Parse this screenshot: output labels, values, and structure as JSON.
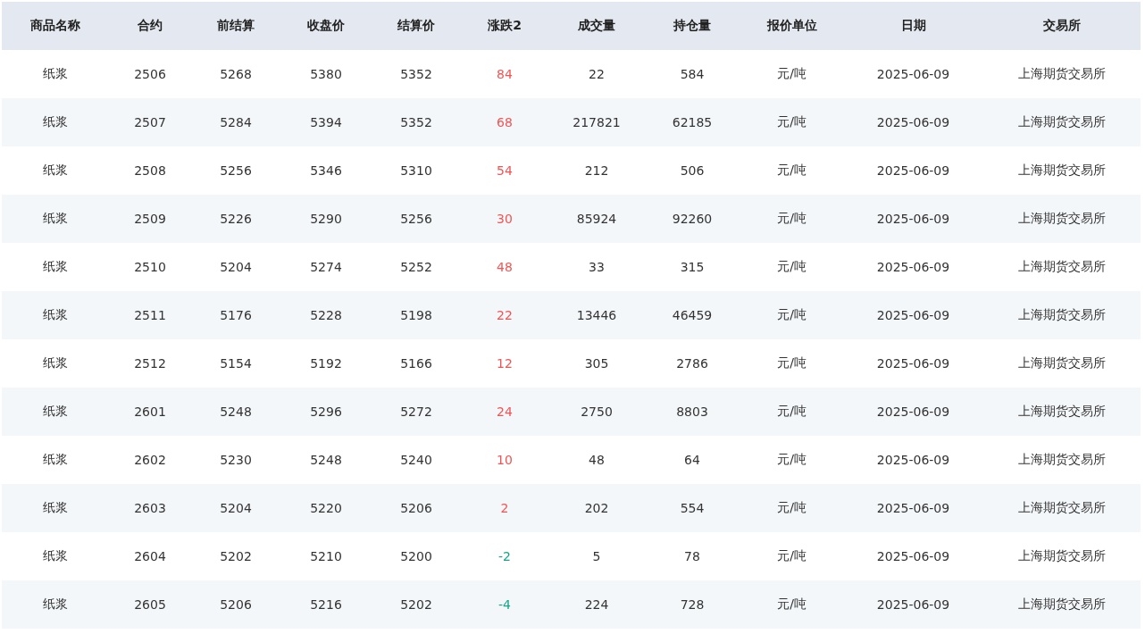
{
  "table": {
    "columns": [
      "商品名称",
      "合约",
      "前结算",
      "收盘价",
      "结算价",
      "涨跌2",
      "成交量",
      "持仓量",
      "报价单位",
      "日期",
      "交易所"
    ],
    "rows": [
      {
        "cells": [
          "纸浆",
          "2506",
          "5268",
          "5380",
          "5352",
          "84",
          "22",
          "584",
          "元/吨",
          "2025-06-09",
          "上海期货交易所"
        ],
        "color": "#f05454"
      },
      {
        "cells": [
          "纸浆",
          "2507",
          "5284",
          "5394",
          "5352",
          "68",
          "217821",
          "62185",
          "元/吨",
          "2025-06-09",
          "上海期货交易所"
        ],
        "color": "#f05454"
      },
      {
        "cells": [
          "纸浆",
          "2508",
          "5256",
          "5346",
          "5310",
          "54",
          "212",
          "506",
          "元/吨",
          "2025-06-09",
          "上海期货交易所"
        ],
        "color": "#f05454"
      },
      {
        "cells": [
          "纸浆",
          "2509",
          "5226",
          "5290",
          "5256",
          "30",
          "85924",
          "92260",
          "元/吨",
          "2025-06-09",
          "上海期货交易所"
        ],
        "color": "#f05454"
      },
      {
        "cells": [
          "纸浆",
          "2510",
          "5204",
          "5274",
          "5252",
          "48",
          "33",
          "315",
          "元/吨",
          "2025-06-09",
          "上海期货交易所"
        ],
        "color": "#f05454"
      },
      {
        "cells": [
          "纸浆",
          "2511",
          "5176",
          "5228",
          "5198",
          "22",
          "13446",
          "46459",
          "元/吨",
          "2025-06-09",
          "上海期货交易所"
        ],
        "color": "#f05454"
      },
      {
        "cells": [
          "纸浆",
          "2512",
          "5154",
          "5192",
          "5166",
          "12",
          "305",
          "2786",
          "元/吨",
          "2025-06-09",
          "上海期货交易所"
        ],
        "color": "#f05454"
      },
      {
        "cells": [
          "纸浆",
          "2601",
          "5248",
          "5296",
          "5272",
          "24",
          "2750",
          "8803",
          "元/吨",
          "2025-06-09",
          "上海期货交易所"
        ],
        "color": "#f05454"
      },
      {
        "cells": [
          "纸浆",
          "2602",
          "5230",
          "5248",
          "5240",
          "10",
          "48",
          "64",
          "元/吨",
          "2025-06-09",
          "上海期货交易所"
        ],
        "color": "#f05454"
      },
      {
        "cells": [
          "纸浆",
          "2603",
          "5204",
          "5220",
          "5206",
          "2",
          "202",
          "554",
          "元/吨",
          "2025-06-09",
          "上海期货交易所"
        ],
        "color": "#f05454"
      },
      {
        "cells": [
          "纸浆",
          "2604",
          "5202",
          "5210",
          "5200",
          "-2",
          "5",
          "78",
          "元/吨",
          "2025-06-09",
          "上海期货交易所"
        ],
        "color": "#14a58a"
      },
      {
        "cells": [
          "纸浆",
          "2605",
          "5206",
          "5216",
          "5202",
          "-4",
          "224",
          "728",
          "元/吨",
          "2025-06-09",
          "上海期货交易所"
        ],
        "color": "#14a58a"
      }
    ]
  }
}
